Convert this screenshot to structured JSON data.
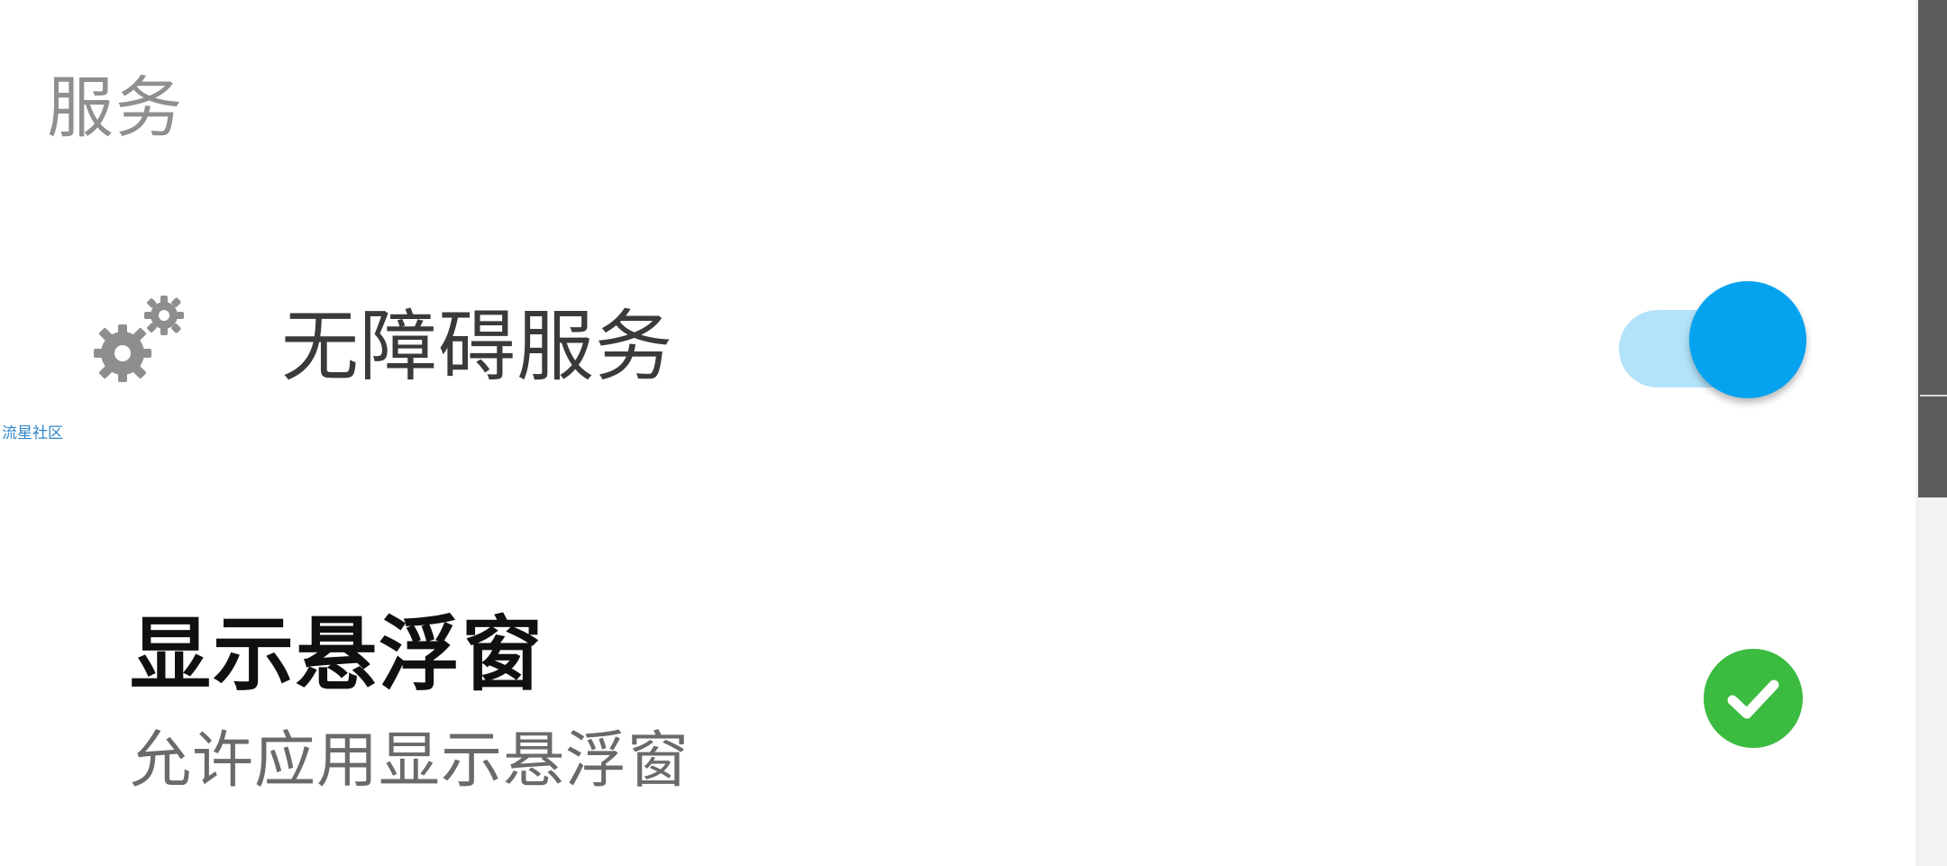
{
  "section": {
    "title": "服务"
  },
  "accessibility": {
    "icon": "gears-icon",
    "label": "无障碍服务",
    "toggle_state": "on",
    "toggle_accent": "#05a3ef",
    "toggle_track": "#b3e3fa"
  },
  "watermark": {
    "text": "流星社区"
  },
  "overlay": {
    "title": "显示悬浮窗",
    "description": "允许应用显示悬浮窗",
    "status_icon": "check-circle-icon",
    "status_color": "#3bbb3f",
    "status": "granted"
  }
}
